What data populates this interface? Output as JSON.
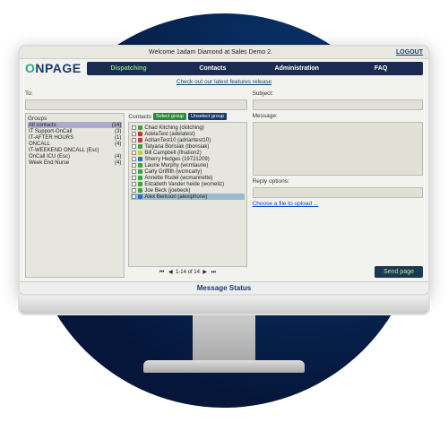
{
  "header": {
    "welcome": "Welcome 1adam Diamond at Sales Demo 2.",
    "logout": "LOGOUT",
    "features": "Check out our latest features release"
  },
  "nav": [
    "Dispatching",
    "Contacts",
    "Administration",
    "FAQ"
  ],
  "compose": {
    "to_label": "To:",
    "subject_label": "Subject:",
    "message_label": "Message:",
    "reply_label": "Reply options:",
    "upload": "Choose a file to upload ...",
    "send": "Send page"
  },
  "groups": {
    "label": "Groups",
    "items": [
      {
        "name": "All contacts",
        "count": "(14)"
      },
      {
        "name": "IT Support-OnCall",
        "count": "(3)"
      },
      {
        "name": "IT-AFTER HOURS",
        "count": "(1)"
      },
      {
        "name": "ONCALL",
        "count": "(4)"
      },
      {
        "name": "IT-WEEKEND ONCALL (Esc)",
        "count": ""
      },
      {
        "name": "OnCall ICU (Esc)",
        "count": "(4)"
      },
      {
        "name": "Week End Nurse",
        "count": "(4)"
      }
    ]
  },
  "contacts": {
    "label": "Contacts",
    "select_btn": "Select group",
    "unselect_btn": "Unselect group",
    "items": [
      "Chad Kitching (ckitching)",
      "AdelaTest (adelatest)",
      "AdrianTest10 (adriantest10)",
      "Tatyana Borisiak (tborisiak)",
      "Bill Campbell (ifnation2)",
      "Sherry Hedges (19721209)",
      "Laurie Murphy (wcmlaurie)",
      "Carly Griffith (wcmcarly)",
      "Annette Rudel (wcmannette)",
      "Elizabeth Vander heide (wcmeliz)",
      "Joe Beck (joebeck)",
      "Alex Berkson (alexiphone)"
    ],
    "pager": "1-14 of 14"
  },
  "status": {
    "header": "Message Status"
  }
}
